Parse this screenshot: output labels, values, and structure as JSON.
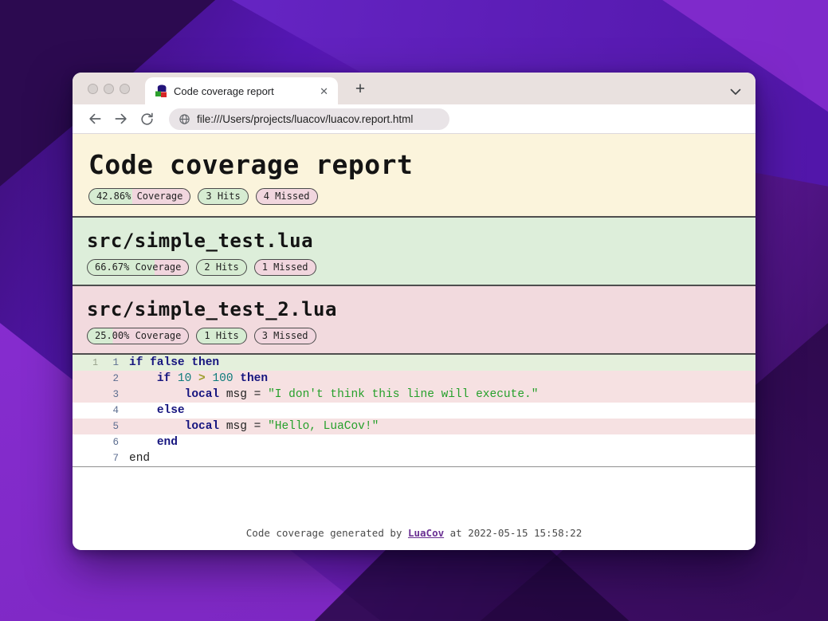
{
  "browser": {
    "tab_title": "Code coverage report",
    "url": "file:///Users/projects/luacov/luacov.report.html",
    "icons": {
      "close_tab": "✕",
      "new_tab": "+"
    }
  },
  "report": {
    "title": "Code coverage report",
    "summary": {
      "coverage_pct": 42.86,
      "coverage_label": "42.86% Coverage",
      "hits_label": "3 Hits",
      "missed_label": "4 Missed"
    },
    "files": [
      {
        "name": "src/simple_test.lua",
        "coverage_pct": 66.67,
        "coverage_label": "66.67% Coverage",
        "hits_label": "2 Hits",
        "missed_label": "1 Missed"
      },
      {
        "name": "src/simple_test_2.lua",
        "coverage_pct": 25.0,
        "coverage_label": "25.00% Coverage",
        "hits_label": "1 Hits",
        "missed_label": "3 Missed"
      }
    ],
    "code": {
      "lines": [
        {
          "n": "1",
          "hits": "1",
          "status": "hit",
          "tokens": [
            {
              "c": "kw",
              "t": "if"
            },
            {
              "c": "pl",
              "t": " "
            },
            {
              "c": "kw",
              "t": "false"
            },
            {
              "c": "pl",
              "t": " "
            },
            {
              "c": "kw",
              "t": "then"
            }
          ]
        },
        {
          "n": "2",
          "hits": "",
          "status": "miss",
          "tokens": [
            {
              "c": "pl",
              "t": "    "
            },
            {
              "c": "kw",
              "t": "if"
            },
            {
              "c": "pl",
              "t": " "
            },
            {
              "c": "num",
              "t": "10"
            },
            {
              "c": "pl",
              "t": " "
            },
            {
              "c": "op",
              "t": ">"
            },
            {
              "c": "pl",
              "t": " "
            },
            {
              "c": "num",
              "t": "100"
            },
            {
              "c": "pl",
              "t": " "
            },
            {
              "c": "kw",
              "t": "then"
            }
          ]
        },
        {
          "n": "3",
          "hits": "",
          "status": "miss",
          "tokens": [
            {
              "c": "pl",
              "t": "        "
            },
            {
              "c": "kw",
              "t": "local"
            },
            {
              "c": "pl",
              "t": " msg = "
            },
            {
              "c": "str",
              "t": "\"I don't think this line will execute.\""
            }
          ]
        },
        {
          "n": "4",
          "hits": "",
          "status": "none",
          "tokens": [
            {
              "c": "pl",
              "t": "    "
            },
            {
              "c": "kw",
              "t": "else"
            }
          ]
        },
        {
          "n": "5",
          "hits": "",
          "status": "miss",
          "tokens": [
            {
              "c": "pl",
              "t": "        "
            },
            {
              "c": "kw",
              "t": "local"
            },
            {
              "c": "pl",
              "t": " msg = "
            },
            {
              "c": "str",
              "t": "\"Hello, LuaCov!\""
            }
          ]
        },
        {
          "n": "6",
          "hits": "",
          "status": "none",
          "tokens": [
            {
              "c": "pl",
              "t": "    "
            },
            {
              "c": "kw",
              "t": "end"
            }
          ]
        },
        {
          "n": "7",
          "hits": "",
          "status": "none",
          "tokens": [
            {
              "c": "pl",
              "t": "end"
            }
          ]
        }
      ]
    },
    "footer": {
      "prefix": "Code coverage generated by ",
      "link": "LuaCov",
      "suffix": " at 2022-05-15 15:58:22"
    }
  },
  "colors": {
    "header_bg": "#fbf4dc",
    "hit_bg": "#ddeeda",
    "miss_bg": "#f2dade",
    "row_hit": "#e4f0dc",
    "row_miss": "#f6e1e2",
    "badge_green": "#d6ecd2",
    "badge_pink": "#f1d6de",
    "tk_keyword": "#16157f",
    "tk_number": "#0f7c7c",
    "tk_operator": "#9d9d2a",
    "tk_string": "#26a02b",
    "link": "#6a3093"
  }
}
